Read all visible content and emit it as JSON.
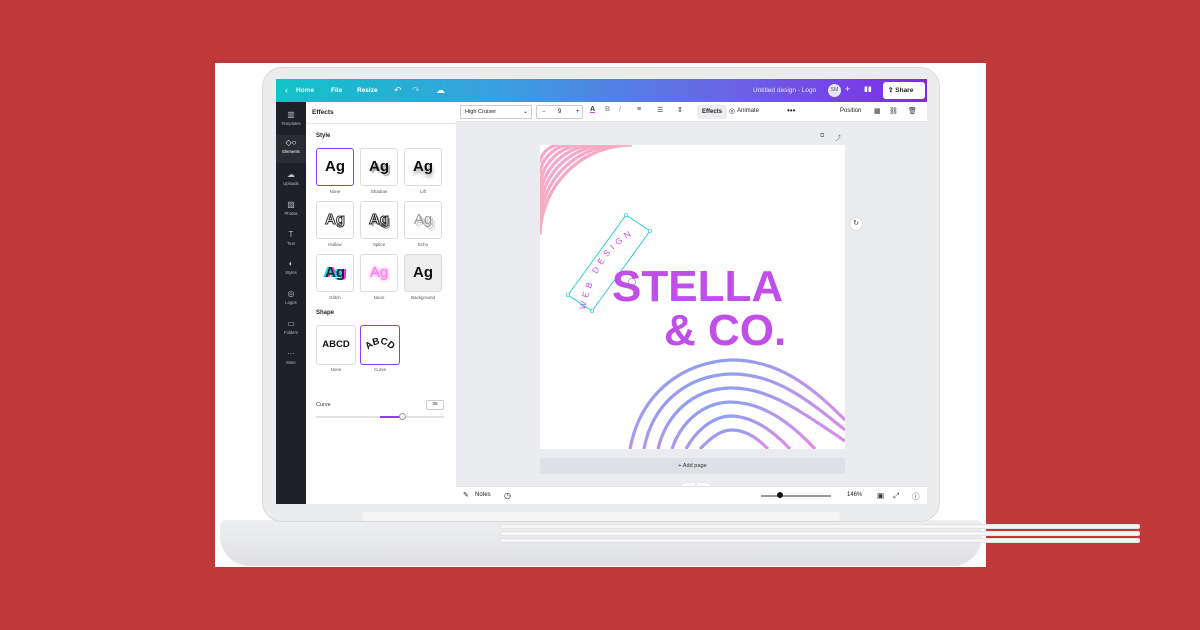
{
  "topbar": {
    "home_label": "Home",
    "file_label": "File",
    "resize_label": "Resize",
    "document_title": "Untitled design - Logo",
    "avatar_initials": "SM",
    "share_label": "Share",
    "gradient_colors": [
      "#10c3c8",
      "#3a9ee0",
      "#6b63e6",
      "#7d2ae8"
    ]
  },
  "leftnav": {
    "items": [
      {
        "label": "Templates",
        "icon": "templates-icon"
      },
      {
        "label": "Elements",
        "icon": "elements-icon"
      },
      {
        "label": "Uploads",
        "icon": "uploads-icon"
      },
      {
        "label": "Photos",
        "icon": "photos-icon"
      },
      {
        "label": "Text",
        "icon": "text-icon"
      },
      {
        "label": "Styles",
        "icon": "styles-icon"
      },
      {
        "label": "Logos",
        "icon": "logos-icon"
      },
      {
        "label": "Folders",
        "icon": "folders-icon"
      },
      {
        "label": "More",
        "icon": "more-icon"
      }
    ],
    "active": "Elements"
  },
  "effects_panel": {
    "title": "Effects",
    "style_section": "Style",
    "preview_text": "Ag",
    "styles": [
      {
        "label": "None"
      },
      {
        "label": "Shadow"
      },
      {
        "label": "Lift"
      },
      {
        "label": "Hollow"
      },
      {
        "label": "Splice"
      },
      {
        "label": "Echo"
      },
      {
        "label": "Glitch"
      },
      {
        "label": "Neon"
      },
      {
        "label": "Background"
      }
    ],
    "selected_style": "None",
    "shape_section": "Shape",
    "shape_preview_text": "ABCD",
    "shapes": [
      {
        "label": "None"
      },
      {
        "label": "Curve"
      }
    ],
    "selected_shape": "Curve",
    "curve_label": "Curve",
    "curve_value": "35",
    "accent_color": "#8b3dff"
  },
  "toolbar": {
    "font": "High Cruiser",
    "font_size": "9",
    "minus": "−",
    "plus": "+",
    "effects_label": "Effects",
    "animate_label": "Animate",
    "more_label": "•••",
    "position_label": "Position"
  },
  "canvas": {
    "curved_text": "WEB DESIGN",
    "headline_line1": "STELLA",
    "headline_line2": "& CO.",
    "headline_color": "#c04ee8",
    "add_page_label": "+ Add page"
  },
  "bottombar": {
    "notes_label": "Notes",
    "zoom_level": "146%"
  }
}
